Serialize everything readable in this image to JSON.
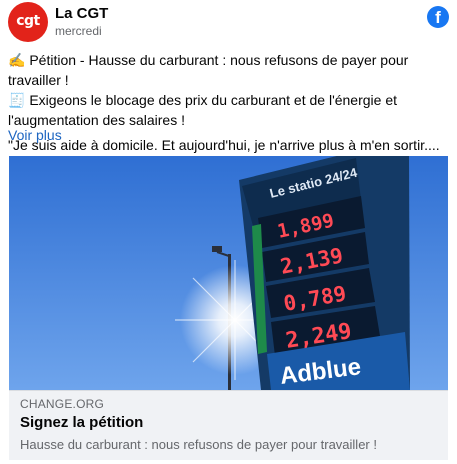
{
  "header": {
    "avatar_text": "cgt",
    "page_name": "La CGT",
    "time": "mercredi"
  },
  "post": {
    "line1": "✍️ Pétition - Hausse du carburant : nous refusons de payer pour travailler !",
    "line2": "🧾 Exigeons le blocage des prix du carburant et de l'énergie et l'augmentation des salaires !",
    "line3": "\"Je suis aide à domicile. Et aujourd'hui, je n'arrive plus à m'en sortir....",
    "see_more": "Voir plus"
  },
  "image": {
    "sign_heading": "Le statio 24/24",
    "prices": [
      "1,899",
      "2,139",
      "0,789",
      "2,249"
    ],
    "brand": "Adblue"
  },
  "link_card": {
    "domain": "CHANGE.ORG",
    "title": "Signez la pétition",
    "description": "Hausse du carburant : nous refusons de payer pour travailler !"
  },
  "colors": {
    "accent": "#1877f2",
    "brand_red": "#e2231a",
    "link": "#1d65c1"
  },
  "icons": [
    "facebook-icon"
  ]
}
